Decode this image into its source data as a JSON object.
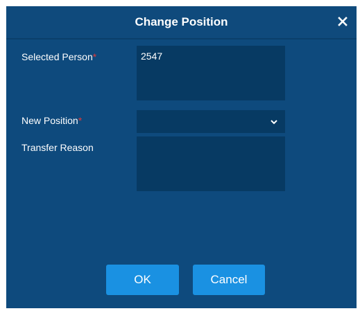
{
  "dialog": {
    "title": "Change Position",
    "close_icon": "close-icon"
  },
  "form": {
    "selected_person": {
      "label": "Selected Person",
      "required_marker": "*",
      "value": "2547"
    },
    "new_position": {
      "label": "New Position",
      "required_marker": "*",
      "selected_value": "",
      "dropdown_icon": "chevron-down-icon"
    },
    "transfer_reason": {
      "label": "Transfer Reason",
      "value": ""
    }
  },
  "buttons": {
    "ok_label": "OK",
    "cancel_label": "Cancel"
  },
  "colors": {
    "dialog_background": "#0e4a7d",
    "field_background": "#073a63",
    "button_background": "#1a91e2",
    "required_marker": "#e53935"
  }
}
